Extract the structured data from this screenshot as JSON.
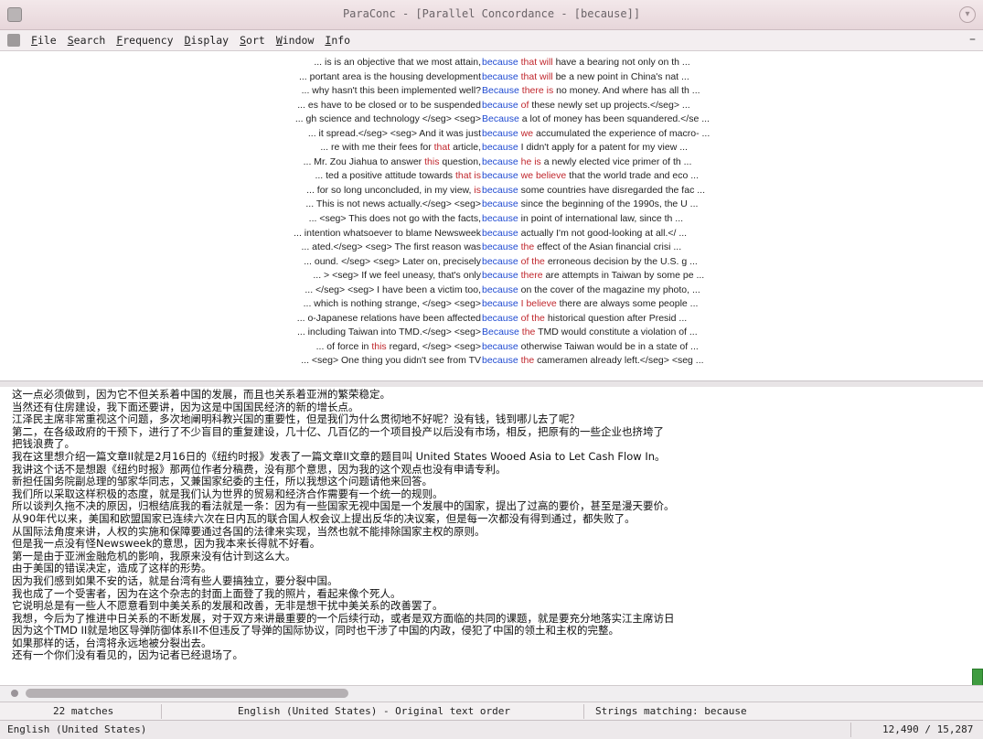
{
  "window": {
    "title": "ParaConc - [Parallel Concordance - [because]]"
  },
  "menu": {
    "items": [
      {
        "acc": "F",
        "rest": "ile"
      },
      {
        "acc": "S",
        "rest": "earch"
      },
      {
        "acc": "F",
        "rest": "requency"
      },
      {
        "acc": "D",
        "rest": "isplay"
      },
      {
        "acc": "S",
        "rest": "ort"
      },
      {
        "acc": "W",
        "rest": "indow"
      },
      {
        "acc": "I",
        "rest": "nfo"
      }
    ]
  },
  "colors": {
    "keyword": "#1f4ad1",
    "collocate": "#c0272d"
  },
  "concordance": [
    {
      "left": "... is is an objective that we most attain,",
      "kw": "because",
      "col": "that will",
      "rest": "have a bearing not only on th ..."
    },
    {
      "left": "... portant area is the housing development",
      "kw": "because",
      "col": "that will",
      "rest": "be a new point in China's nat ..."
    },
    {
      "left": "... why hasn't this been implemented well?",
      "kw": "Because",
      "col": "there is",
      "rest": "no money. And where has all th ..."
    },
    {
      "left": "... es have to be closed or to be suspended",
      "kw": "because",
      "col": "of",
      "rest": "these newly set up projects.</seg> ..."
    },
    {
      "left": "... gh science and technology </seg> <seg>",
      "kw": "Because",
      "col": "",
      "rest": "a lot of money has been squandered.</se ..."
    },
    {
      "left": "... it spread.</seg> <seg> And it was just",
      "kw": "because",
      "col": "we",
      "rest": "accumulated the experience of macro- ..."
    },
    {
      "left": "... re with me their fees for",
      "leftHl": "that",
      "leftTail": " article,",
      "kw": "because",
      "col": "",
      "rest": "I didn't apply for a patent for my view ..."
    },
    {
      "left": "... Mr. Zou Jiahua to answer",
      "leftHl": "this",
      "leftTail": " question,",
      "kw": "because",
      "col": "he is",
      "rest": "a newly elected vice primer of th ..."
    },
    {
      "left": "... ted a positive attitude towards",
      "leftHl": "that is",
      "leftTail": "",
      "kw": "because",
      "col": "we believe",
      "rest": "that the world trade and eco ..."
    },
    {
      "left": "... for so long unconcluded, in my view,",
      "leftHl": "is",
      "leftTail": "",
      "kw": "because",
      "col": "",
      "rest": "some countries have disregarded the fac ..."
    },
    {
      "left": "... This is not news actually.</seg> <seg>",
      "kw": "because",
      "col": "",
      "rest": "since the beginning of the 1990s, the U ..."
    },
    {
      "left": "... <seg> This does not go with the facts,",
      "kw": "because",
      "col": "",
      "rest": "in point of international law, since th ..."
    },
    {
      "left": "... intention whatsoever to blame Newsweek",
      "kw": "because",
      "col": "",
      "rest": "actually I'm not good-looking at all.</ ..."
    },
    {
      "left": "... ated.</seg> <seg> The first reason was",
      "kw": "because",
      "col": "the",
      "rest": "effect of the Asian financial crisi ..."
    },
    {
      "left": "... ound. </seg> <seg> Later on, precisely",
      "kw": "because",
      "col": "of the",
      "rest": "erroneous decision by the U.S. g ..."
    },
    {
      "left": "... > <seg> If we feel uneasy, that's only",
      "kw": "because",
      "col": "there",
      "rest": "are attempts in Taiwan by some pe ..."
    },
    {
      "left": "... </seg> <seg> I have been a victim too,",
      "kw": "because",
      "col": "",
      "rest": "on the cover of the magazine my photo, ..."
    },
    {
      "left": "... which is nothing strange, </seg> <seg>",
      "kw": "because",
      "col": "I believe",
      "rest": "there are always some people ..."
    },
    {
      "left": "... o-Japanese relations have been affected",
      "kw": "because",
      "col": "of the",
      "rest": "historical question after Presid ..."
    },
    {
      "left": "... including Taiwan into TMD.</seg> <seg>",
      "kw": "Because",
      "col": "the",
      "rest": "TMD would constitute a violation of ..."
    },
    {
      "left": "... of force in",
      "leftHl": "this",
      "leftTail": " regard, </seg> <seg>",
      "kw": "because",
      "col": "",
      "rest": "otherwise Taiwan would be in a state of ..."
    },
    {
      "left": "... <seg> One thing you didn't see from TV",
      "kw": "because",
      "col": "the",
      "rest": "cameramen already left.</seg> <seg ..."
    }
  ],
  "chinese_lines": [
    "这一点必须做到，因为它不但关系着中国的发展，而且也关系着亚洲的繁荣稳定。",
    "当然还有住房建设，我下面还要讲，因为这是中国国民经济的新的增长点。",
    "江泽民主席非常重视这个问题，多次地阐明科教兴国的重要性，但是我们为什么贯彻地不好呢？没有钱，钱到哪儿去了呢？",
    "第二，在各级政府的干预下，进行了不少盲目的重复建设，几十亿、几百亿的一个项目投产以后没有市场，相反，把原有的一些企业也挤垮了",
    "把钱浪费了。",
    "我在这里想介绍一篇文章II就是2月16日的《纽约时报》发表了一篇文章II文章的题目叫 United States Wooed Asia to Let Cash Flow In。",
    "我讲这个话不是想跟《纽约时报》那两位作者分稿费，没有那个意思，因为我的这个观点也没有申请专利。",
    "新担任国务院副总理的邹家华同志，又兼国家纪委的主任，所以我想这个问题请他来回答。",
    "我们所以采取这样积极的态度，就是我们认为世界的贸易和经济合作需要有一个统一的规则。",
    "所以谈判久拖不决的原因，归根结底我的看法就是一条：因为有一些国家无视中国是一个发展中的国家，提出了过高的要价，甚至是漫天要价。",
    "从90年代以来，美国和欧盟国家已连续六次在日内瓦的联合国人权会议上提出反华的决议案，但是每一次都没有得到通过，都失败了。",
    "从国际法角度来讲，人权的实施和保障要通过各国的法律来实现，当然也就不能排除国家主权的原则。",
    "但是我一点没有怪Newsweek的意思，因为我本来长得就不好看。",
    "第一是由于亚洲金融危机的影响，我原来没有估计到这么大。",
    "由于美国的错误决定，造成了这样的形势。",
    "因为我们感到如果不安的话，就是台湾有些人要搞独立，要分裂中国。",
    "我也成了一个受害者，因为在这个杂志的封面上面登了我的照片，看起来像个死人。",
    "它说明总是有一些人不愿意看到中美关系的发展和改善，无非是想干扰中美关系的改善罢了。",
    "我想，今后为了推进中日关系的不断发展，对于双方来讲最重要的一个后续行动，或者是双方面临的共同的课题，就是要充分地落实江主席访日",
    "因为这个TMD II就是地区导弹防御体系II不但违反了导弹的国际协议，同时也干涉了中国的内政，侵犯了中国的领土和主权的完整。",
    "如果那样的话，台湾将永远地被分裂出去。",
    "还有一个你们没有看见的，因为记者已经退场了。"
  ],
  "status": {
    "matches": "22 matches",
    "language_order": "English (United States) - Original text order",
    "strings": "Strings matching: because"
  },
  "bottom": {
    "language": "English (United States)",
    "position": "12,490 / 15,287"
  },
  "scroll": {
    "horizontal_fraction": 0.34
  }
}
